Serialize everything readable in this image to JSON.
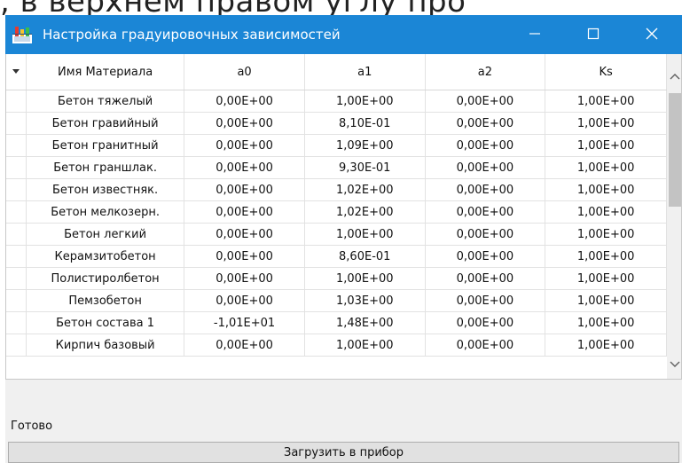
{
  "background_caption": ", в верхнем правом углу про",
  "window": {
    "title": "Настройка градуировочных зависимостей",
    "icons": {
      "app": "settings-app-icon",
      "minimize": "minimize-icon",
      "maximize": "maximize-icon",
      "close": "close-icon"
    }
  },
  "grid": {
    "columns": [
      "Имя Материала",
      "a0",
      "a1",
      "a2",
      "Ks"
    ],
    "rows": [
      [
        "Бетон тяжелый",
        "0,00E+00",
        "1,00E+00",
        "0,00E+00",
        "1,00E+00"
      ],
      [
        "Бетон гравийный",
        "0,00E+00",
        "8,10E-01",
        "0,00E+00",
        "1,00E+00"
      ],
      [
        "Бетон гранитный",
        "0,00E+00",
        "1,09E+00",
        "0,00E+00",
        "1,00E+00"
      ],
      [
        "Бетон граншлак.",
        "0,00E+00",
        "9,30E-01",
        "0,00E+00",
        "1,00E+00"
      ],
      [
        "Бетон известняк.",
        "0,00E+00",
        "1,02E+00",
        "0,00E+00",
        "1,00E+00"
      ],
      [
        "Бетон мелкозерн.",
        "0,00E+00",
        "1,02E+00",
        "0,00E+00",
        "1,00E+00"
      ],
      [
        "Бетон легкий",
        "0,00E+00",
        "1,00E+00",
        "0,00E+00",
        "1,00E+00"
      ],
      [
        "Керамзитобетон",
        "0,00E+00",
        "8,60E-01",
        "0,00E+00",
        "1,00E+00"
      ],
      [
        "Полистиролбетон",
        "0,00E+00",
        "1,00E+00",
        "0,00E+00",
        "1,00E+00"
      ],
      [
        "Пемзобетон",
        "0,00E+00",
        "1,03E+00",
        "0,00E+00",
        "1,00E+00"
      ],
      [
        "Бетон состава 1",
        "-1,01E+01",
        "1,48E+00",
        "0,00E+00",
        "1,00E+00"
      ],
      [
        "Кирпич базовый",
        "0,00E+00",
        "1,00E+00",
        "0,00E+00",
        "1,00E+00"
      ]
    ]
  },
  "status": "Готово",
  "load_button_label": "Загрузить в прибор",
  "colors": {
    "titlebar": "#1b86d6",
    "window_bg": "#f0f0f0",
    "grid_bg": "#ffffff",
    "button_bg": "#e1e1e1"
  }
}
